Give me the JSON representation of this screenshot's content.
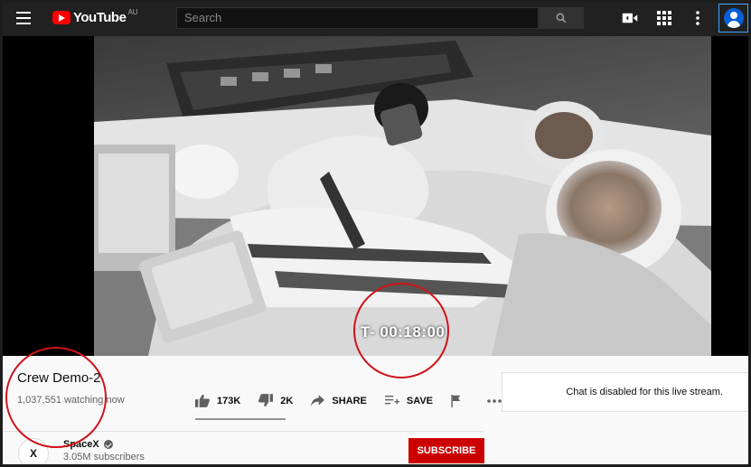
{
  "header": {
    "logo_text": "YouTube",
    "region": "AU",
    "search_placeholder": "Search"
  },
  "video": {
    "countdown": "T- 00:18:00"
  },
  "info": {
    "title": "Crew Demo-2",
    "views": "1,037,551 watching now",
    "like_count": "173K",
    "dislike_count": "2K",
    "share_label": "SHARE",
    "save_label": "SAVE"
  },
  "channel": {
    "name": "SpaceX",
    "avatar_text": "X",
    "subscribers": "3.05M subscribers",
    "subscribe_label": "SUBSCRIBE"
  },
  "chat": {
    "message": "Chat is disabled for this live stream."
  },
  "colors": {
    "brand_red": "#ff0000",
    "subscribe_red": "#cc0000",
    "annotation_red": "#d0141c",
    "header_bg": "#212121"
  },
  "icons": [
    "menu-icon",
    "youtube-logo-icon",
    "search-icon",
    "video-camera-icon",
    "apps-grid-icon",
    "more-vert-icon",
    "account-icon",
    "thumbs-up-icon",
    "thumbs-down-icon",
    "share-icon",
    "playlist-add-icon",
    "flag-icon",
    "more-horiz-icon",
    "verified-icon"
  ]
}
